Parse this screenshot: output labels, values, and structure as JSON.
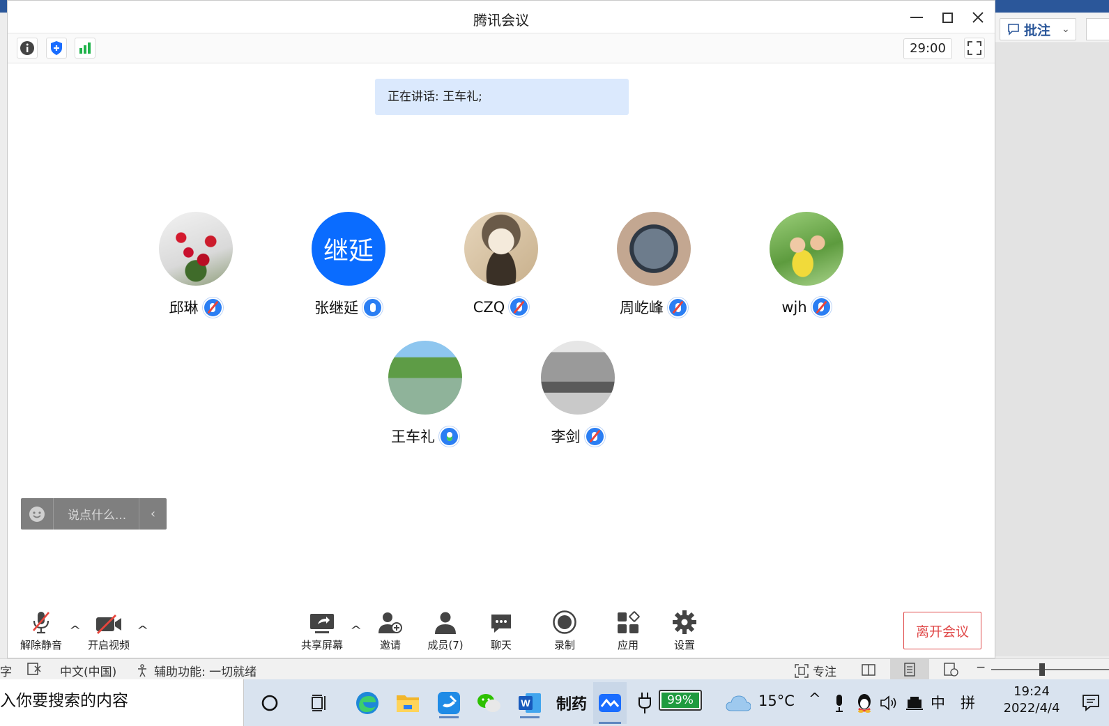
{
  "word": {
    "annotate_label": "批注"
  },
  "meeting": {
    "title": "腾讯会议",
    "timer": "29:00",
    "speaking": "正在讲话: 王车礼;",
    "participants": [
      {
        "name": "邱琳",
        "mic": "muted",
        "avatar": "photo-red-berries"
      },
      {
        "name": "张继延",
        "mic": "on",
        "avatar": "text",
        "avatar_text": "继延",
        "avatar_color": "#0a6cff"
      },
      {
        "name": "CZQ",
        "mic": "muted",
        "avatar": "photo-caricature"
      },
      {
        "name": "周屹峰",
        "mic": "muted",
        "avatar": "photo-calligraphy-seal"
      },
      {
        "name": "wjh",
        "mic": "muted",
        "avatar": "photo-children"
      },
      {
        "name": "王车礼",
        "mic": "speaking",
        "avatar": "photo-lake"
      },
      {
        "name": "李剑",
        "mic": "muted",
        "avatar": "photo-cathedral"
      }
    ],
    "chat": {
      "placeholder": "说点什么...",
      "collapse_icon": "chevron-left-icon",
      "emoji_icon": "smiley-icon"
    },
    "toolbar": {
      "unmute": "解除静音",
      "start_video": "开启视频",
      "share_screen": "共享屏幕",
      "invite": "邀请",
      "members": "成员(7)",
      "chat": "聊天",
      "record": "录制",
      "apps": "应用",
      "settings": "设置",
      "leave": "离开会议"
    }
  },
  "statusbar": {
    "partial_left": "字",
    "language": "中文(中国)",
    "accessibility": "辅助功能: 一切就绪",
    "focus": "专注"
  },
  "taskbar": {
    "search_placeholder": "入你要搜索的内容",
    "pinned_apps": [
      "cortana-icon",
      "task-view-icon",
      "edge-icon",
      "file-explorer-icon",
      "feishu-icon",
      "wechat-icon",
      "word-icon",
      "zhiyao-icon",
      "tencent-meeting-icon"
    ],
    "pinned_label_zhiyao": "制药",
    "battery": "99%",
    "temperature": "15°C",
    "ime_lang": "中",
    "ime_mode": "拼",
    "time": "19:24",
    "date": "2022/4/4"
  }
}
